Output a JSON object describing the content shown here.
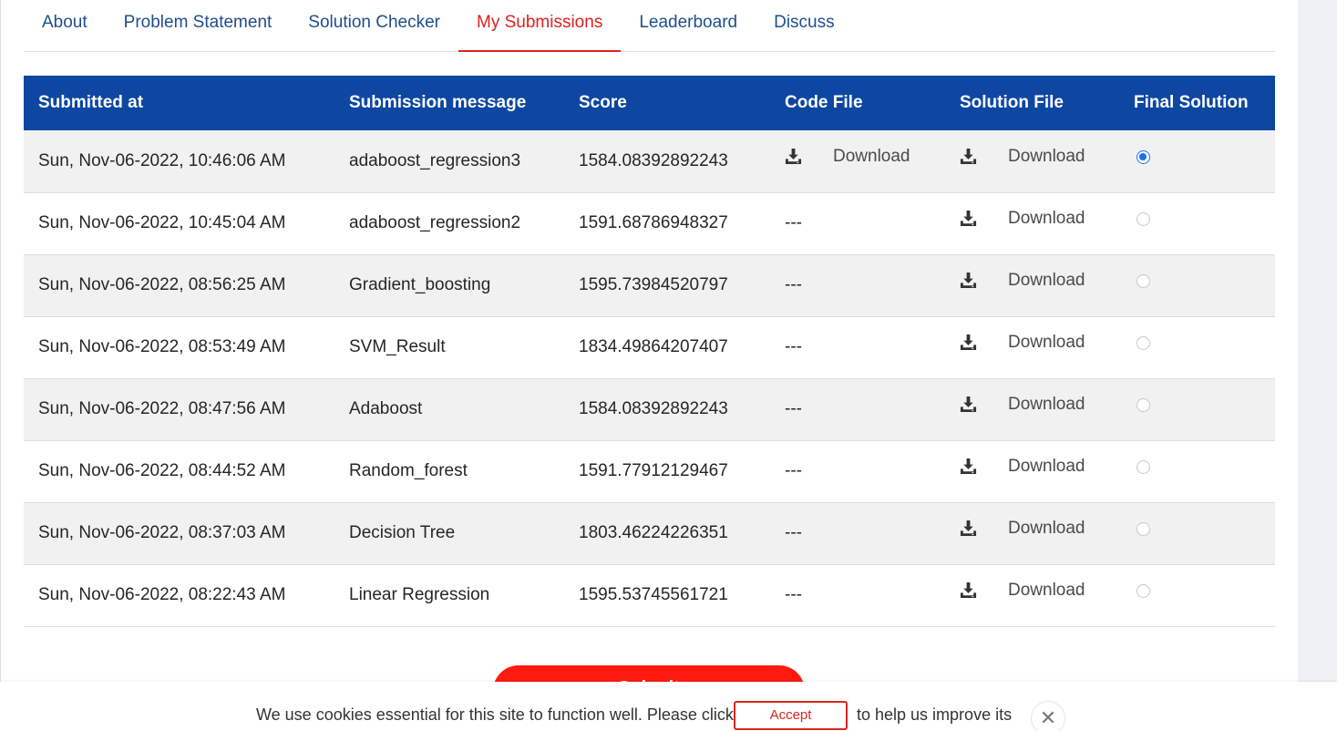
{
  "tabs": [
    {
      "label": "About",
      "active": false
    },
    {
      "label": "Problem Statement",
      "active": false
    },
    {
      "label": "Solution Checker",
      "active": false
    },
    {
      "label": "My Submissions",
      "active": true
    },
    {
      "label": "Leaderboard",
      "active": false
    },
    {
      "label": "Discuss",
      "active": false
    }
  ],
  "table": {
    "headers": [
      "Submitted at",
      "Submission message",
      "Score",
      "Code File",
      "Solution File",
      "Final Solution"
    ],
    "download_label": "Download",
    "rows": [
      {
        "submitted_at": "Sun, Nov-06-2022, 10:46:06 AM",
        "message": "adaboost_regression3",
        "score": "1584.08392892243",
        "code_file": "Download",
        "solution_file": "Download",
        "final": true
      },
      {
        "submitted_at": "Sun, Nov-06-2022, 10:45:04 AM",
        "message": "adaboost_regression2",
        "score": "1591.68786948327",
        "code_file": "---",
        "solution_file": "Download",
        "final": false
      },
      {
        "submitted_at": "Sun, Nov-06-2022, 08:56:25 AM",
        "message": "Gradient_boosting",
        "score": "1595.73984520797",
        "code_file": "---",
        "solution_file": "Download",
        "final": false
      },
      {
        "submitted_at": "Sun, Nov-06-2022, 08:53:49 AM",
        "message": "SVM_Result",
        "score": "1834.49864207407",
        "code_file": "---",
        "solution_file": "Download",
        "final": false
      },
      {
        "submitted_at": "Sun, Nov-06-2022, 08:47:56 AM",
        "message": "Adaboost",
        "score": "1584.08392892243",
        "code_file": "---",
        "solution_file": "Download",
        "final": false
      },
      {
        "submitted_at": "Sun, Nov-06-2022, 08:44:52 AM",
        "message": "Random_forest",
        "score": "1591.77912129467",
        "code_file": "---",
        "solution_file": "Download",
        "final": false
      },
      {
        "submitted_at": "Sun, Nov-06-2022, 08:37:03 AM",
        "message": "Decision Tree",
        "score": "1803.46224226351",
        "code_file": "---",
        "solution_file": "Download",
        "final": false
      },
      {
        "submitted_at": "Sun, Nov-06-2022, 08:22:43 AM",
        "message": "Linear Regression",
        "score": "1595.53745561721",
        "code_file": "---",
        "solution_file": "Download",
        "final": false
      }
    ]
  },
  "submit_button": {
    "label": "Submit"
  },
  "cookie": {
    "text_before": "We use cookies essential for this site to function well. Please click",
    "accept_label": "Accept",
    "text_after": "to help us improve its",
    "close_icon": "close-icon"
  },
  "colors": {
    "header_bg": "#0e47a1",
    "active_tab": "#e0201f",
    "tab_text": "#1f4e8c",
    "submit_bg": "#ff1a0f",
    "radio_checked": "#1a73e8"
  }
}
